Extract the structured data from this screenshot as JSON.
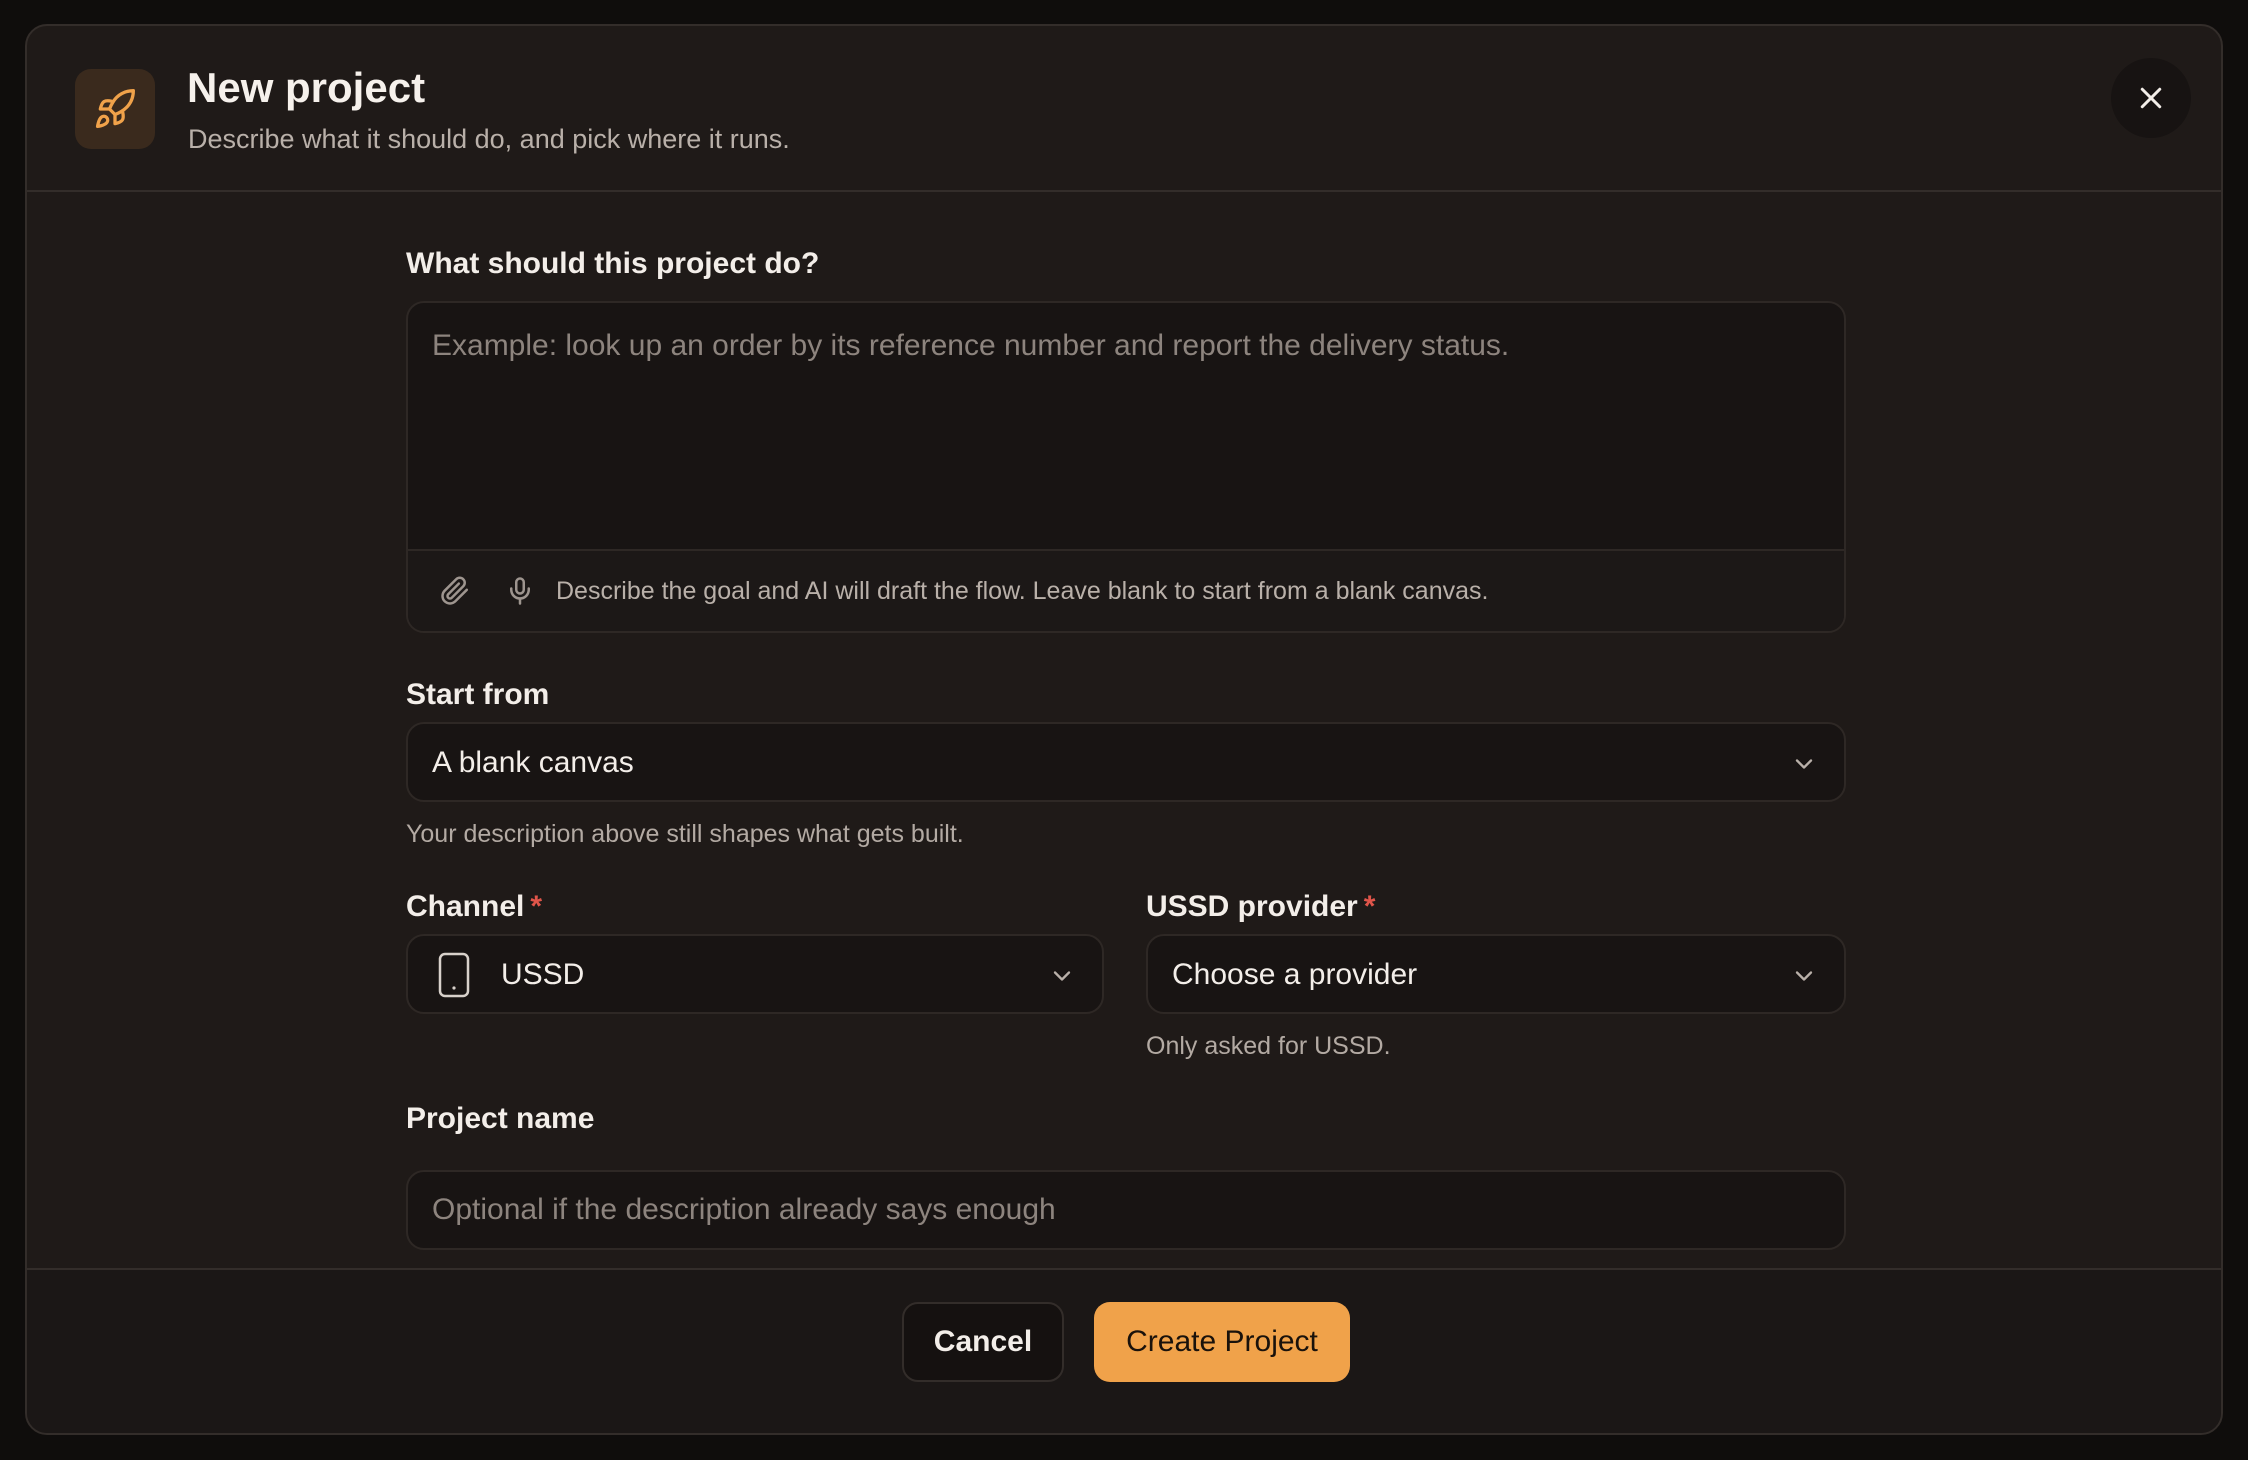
{
  "dialog": {
    "title": "New project",
    "subtitle": "Describe what it should do, and pick where it runs.",
    "header_icon": "rocket-icon",
    "close_icon": "close-icon"
  },
  "description": {
    "label": "What should this project do?",
    "value": "",
    "placeholder": "Example: look up an order by its reference number and report the delivery status.",
    "attach_icon": "paperclip-icon",
    "mic_icon": "microphone-icon",
    "hint": "Describe the goal and AI will draft the flow. Leave blank to start from a blank canvas."
  },
  "start_from": {
    "label": "Start from",
    "selected": "A blank canvas",
    "helper": "Your description above still shapes what gets built."
  },
  "channel": {
    "label": "Channel",
    "required_mark": "*",
    "selected": "USSD",
    "icon": "mobile-phone-icon"
  },
  "ussd_provider": {
    "label": "USSD provider",
    "required_mark": "*",
    "selected": "Choose a provider",
    "helper": "Only asked for USSD."
  },
  "project_name": {
    "label": "Project name",
    "value": "",
    "placeholder": "Optional if the description already says enough"
  },
  "actions": {
    "cancel_label": "Cancel",
    "create_label": "Create Project"
  },
  "colors": {
    "accent": "#f0a24a",
    "required": "#e0554a",
    "modal_bg": "#1f1a18"
  }
}
